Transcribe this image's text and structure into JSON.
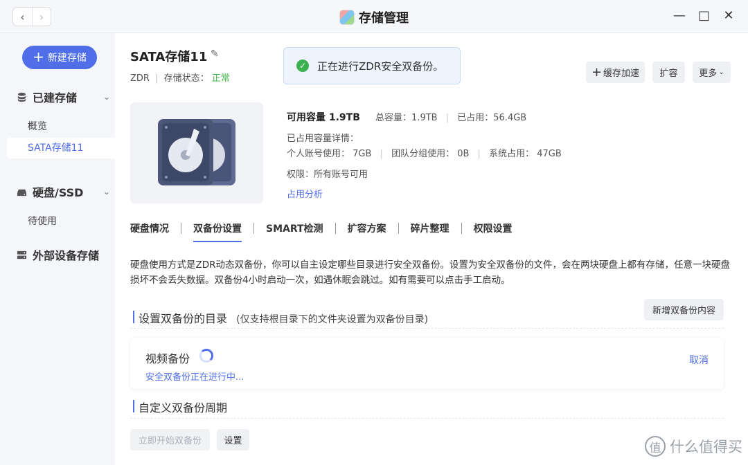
{
  "window": {
    "title": "存储管理",
    "back_glyph": "‹",
    "forward_glyph": "›",
    "minimize_glyph": "—",
    "maximize_glyph": "□",
    "close_glyph": "✕"
  },
  "sidebar": {
    "new_button": "新建存储",
    "built_storage": {
      "label": "已建存储",
      "items": [
        "概览",
        "SATA存储11"
      ]
    },
    "disk_ssd": {
      "label": "硬盘/SSD",
      "items": [
        "待使用"
      ]
    },
    "external": {
      "label": "外部设备存储"
    }
  },
  "pool": {
    "name": "SATA存储11",
    "type": "ZDR",
    "status_label": "存储状态：",
    "status_value": "正常",
    "status_color": "#41b649"
  },
  "toast": {
    "message": "正在进行ZDR安全双备份。"
  },
  "top_buttons": {
    "cache": "缓存加速",
    "expand": "扩容",
    "more": "更多"
  },
  "capacity": {
    "available": "可用容量 1.9TB",
    "total": "总容量：1.9TB",
    "used": "已占用：56.4GB",
    "detail_title": "已占用容量详情：",
    "personal": "个人账号使用： 7GB",
    "team": "团队分组使用： 0B",
    "system": "系统占用： 47GB",
    "permission": "权限：所有账号可用",
    "analysis_link": "占用分析"
  },
  "tabs": [
    "硬盘情况",
    "双备份设置",
    "SMART检测",
    "扩容方案",
    "碎片整理",
    "权限设置"
  ],
  "active_tab": "双备份设置",
  "description": "硬盘使用方式是ZDR动态双备份，你可以自主设定哪些目录进行安全双备份。设置为安全双备份的文件，会在两块硬盘上都有存储，任意一块硬盘损坏不会丢失数据。双备份4小时启动一次，如遇休眠会跳过。如有需要可以点击手工启动。",
  "backup_dirs": {
    "heading": "设置双备份的目录",
    "note": "(仅支持根目录下的文件夹设置为双备份目录)",
    "add_button": "新增双备份内容",
    "items": [
      {
        "name": "视频备份",
        "status": "安全双备份正在进行中...",
        "action": "取消"
      }
    ]
  },
  "schedule": {
    "heading": "自定义双备份周期",
    "start_button": "立即开始双备份",
    "settings_button": "设置"
  },
  "watermark": {
    "logo": "值",
    "text": "什么值得买"
  },
  "accent_color": "#4f6ee8"
}
